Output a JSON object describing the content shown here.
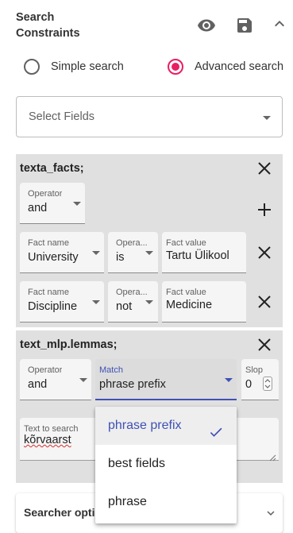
{
  "header": {
    "title_line1": "Search",
    "title_line2": "Constraints",
    "icons": [
      "eye-icon",
      "save-icon",
      "chevron-up-icon"
    ]
  },
  "search_mode": {
    "options": [
      {
        "label": "Simple search",
        "selected": false
      },
      {
        "label": "Advanced search",
        "selected": true
      }
    ]
  },
  "select_fields": {
    "placeholder": "Select Fields"
  },
  "facts_group": {
    "title": "texta_facts;",
    "operator": {
      "label": "Operator",
      "value": "and"
    },
    "rows": [
      {
        "fact_name_label": "Fact name",
        "fact_name": "University",
        "operator_label": "Opera...",
        "operator": "is",
        "fact_value_label": "Fact value",
        "fact_value": "Tartu Ülikool"
      },
      {
        "fact_name_label": "Fact name",
        "fact_name": "Discipline",
        "operator_label": "Opera...",
        "operator": "not",
        "fact_value_label": "Fact value",
        "fact_value": "Medicine"
      }
    ]
  },
  "lemmas_group": {
    "title": "text_mlp.lemmas;",
    "operator": {
      "label": "Operator",
      "value": "and"
    },
    "match": {
      "label": "Match",
      "value": "phrase prefix"
    },
    "slop": {
      "label": "Slop",
      "value": "0"
    },
    "text_to_search": {
      "label": "Text to search",
      "value": "kõrvaarst"
    }
  },
  "match_menu": {
    "items": [
      {
        "label": "phrase prefix",
        "selected": true
      },
      {
        "label": "best fields",
        "selected": false
      },
      {
        "label": "phrase",
        "selected": false
      }
    ]
  },
  "searcher_options": {
    "label": "Searcher options"
  },
  "colors": {
    "accent": "#e91e63",
    "primary": "#3f51b5",
    "panel": "#e0e0e0"
  }
}
